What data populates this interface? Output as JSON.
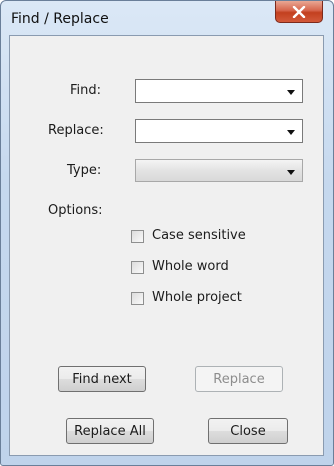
{
  "window": {
    "title": "Find / Replace"
  },
  "form": {
    "find": {
      "label": "Find:",
      "value": ""
    },
    "replace": {
      "label": "Replace:",
      "value": ""
    },
    "type": {
      "label": "Type:",
      "value": ""
    },
    "options_label": "Options:",
    "options": [
      {
        "label": "Case sensitive",
        "checked": false
      },
      {
        "label": "Whole word",
        "checked": false
      },
      {
        "label": "Whole project",
        "checked": false
      }
    ]
  },
  "buttons": {
    "find_next": "Find next",
    "replace": "Replace",
    "replace_all": "Replace All",
    "close": "Close"
  },
  "icons": {
    "close": "close-icon",
    "dropdown": "chevron-down-icon"
  },
  "colors": {
    "close_button": "#c3401f",
    "frame": "#c5d8ee"
  }
}
